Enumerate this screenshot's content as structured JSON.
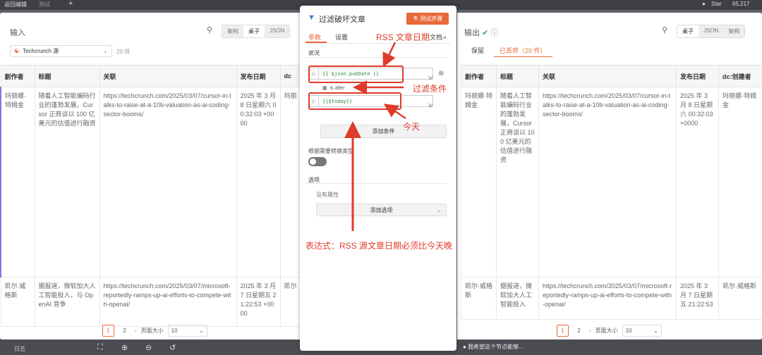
{
  "topbar": {
    "back_label": "返回编辑",
    "tab_label": "测试",
    "star_label": "Star",
    "star_count": "65,217"
  },
  "input_panel": {
    "title": "输入",
    "view_modes": [
      "架构",
      "桌子",
      "JSON"
    ],
    "source": "Techcrunch 源",
    "count": "20 项",
    "columns": [
      "創作者",
      "标题",
      "关联",
      "发布日期",
      "dc"
    ],
    "rows": [
      {
        "creator": "玛丽娜·特姆金",
        "title": "随着人工智能编码行业的蓬勃发展，Cursor 正商谈以 100 亿美元的估值进行融资",
        "link": "https://techcrunch.com/2025/03/07/cursor-in-talks-to-raise-at-a-10b-valuation-as-ai-coding-sector-booms/",
        "date": "2025 年 3 月 8 日星期六 00:32:03 +0000",
        "dc": "玛丽"
      },
      {
        "creator": "凯尔·威格斯",
        "title": "据报道，微软加大人工智能投入，与 OpenAI 竞争",
        "link": "https://techcrunch.com/2025/03/07/microsoft-reportedly-ramps-up-ai-efforts-to-compete-with-openai/",
        "date": "2025 年 3 月 7 日星期五 21:22:53 +0000",
        "dc": "凯尔"
      }
    ],
    "pages": [
      "1",
      "2"
    ],
    "page_size_label": "页面大小",
    "page_size": "10"
  },
  "node_panel": {
    "title": "过滤破坏文章",
    "test_button": "测试步骤",
    "tabs": [
      "参数",
      "设置"
    ],
    "docs": "文档",
    "conditions_label": "状况",
    "left_value": "{{ $json.pubDate }}",
    "operator": "is after",
    "right_value": "{{$today}}",
    "add_condition": "添加条件",
    "convert_label": "根据需要转换类型",
    "options_label": "选项",
    "no_props": "没有属性",
    "add_option": "添加选项"
  },
  "output_panel": {
    "title": "输出",
    "view_modes": [
      "桌子",
      "JSON",
      "架构"
    ],
    "tabs": [
      "保留",
      "已丢弃（20 件）"
    ],
    "columns": [
      "創作者",
      "标题",
      "关联",
      "发布日期",
      "dc:创建者"
    ],
    "rows": [
      {
        "creator": "玛丽娜·特姆金",
        "title": "随着人工智能编码行业的蓬勃发展，Cursor 正商谈以 100 亿美元的估值进行融资",
        "link": "https://techcrunch.com/2025/03/07/cursor-in-talks-to-raise-at-a-10b-valuation-as-ai-coding-sector-booms/",
        "date": "2025 年 3 月 8 日星期六 00:32:03 +0000",
        "dc": "玛丽娜·特姆金"
      },
      {
        "creator": "凯尔·威格斯",
        "title": "据报道，微软加大人工智能投入",
        "link": "https://techcrunch.com/2025/03/07/microsoft-reportedly-ramps-up-ai-efforts-to-compete-with-openai/",
        "date": "2025 年 3 月 7 日星期五 21:22:53",
        "dc": "凯尔·威格斯"
      }
    ],
    "pages": [
      "1",
      "2"
    ],
    "page_size_label": "页面大小",
    "page_size": "10"
  },
  "annotations": {
    "rss_date": "RSS 文章日期",
    "filter_cond": "过滤条件",
    "today": "今天",
    "expression": "表达式：RSS 源文章日期必须比今天晚"
  },
  "bottombar": {
    "hint": "我希望这个节点能够...",
    "logs": "日志"
  },
  "colors": {
    "accent": "#e8693a",
    "annotation": "#e03b2a",
    "expr_green": "#2b8a3e"
  }
}
